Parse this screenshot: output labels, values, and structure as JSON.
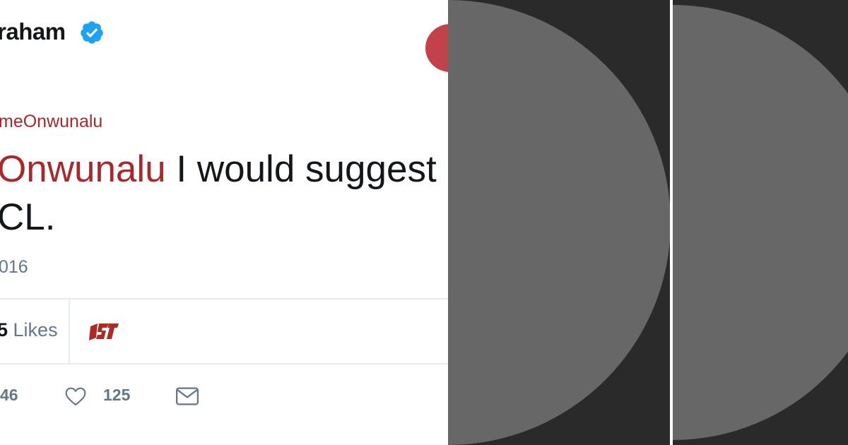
{
  "tweet": {
    "author_name": "raham",
    "reply_to": "meOnwunalu",
    "text_mention": "Onwunalu",
    "text_line1_rest": " I would suggest",
    "text_line2": "CL.",
    "timestamp": "016",
    "likes_count": "5",
    "likes_label": " Likes",
    "retweet_count": "46",
    "like_count": "125"
  },
  "icons": {
    "verified": "verified-badge-icon",
    "logo": "avatar-logo-icon",
    "like": "heart-icon",
    "dm": "envelope-icon"
  },
  "colors": {
    "mention": "#a8282b",
    "verified": "#1da1f2",
    "follow_button": "#c2414a",
    "placeholder_dark": "#2a2a2a",
    "placeholder_circle": "#676767"
  }
}
